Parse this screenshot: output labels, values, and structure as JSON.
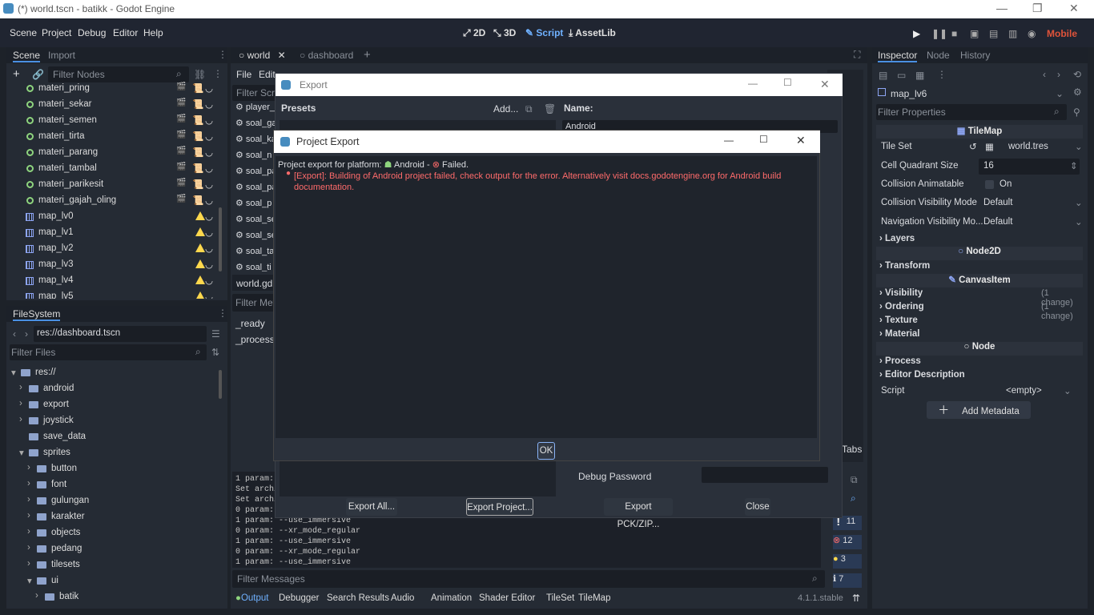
{
  "window": {
    "title": "(*) world.tscn - batikk - Godot Engine",
    "min": "—",
    "restore": "❐",
    "close": "✕"
  },
  "menu": [
    "Scene",
    "Project",
    "Debug",
    "Editor",
    "Help"
  ],
  "workspace": {
    "w2d": "2D",
    "w3d": "3D",
    "script": "Script",
    "assetlib": "AssetLib",
    "renderer": "Mobile"
  },
  "scene_dock": {
    "tabs": [
      "Scene",
      "Import"
    ],
    "filter_placeholder": "Filter Nodes",
    "nodes": [
      "materi_pring",
      "materi_sekar",
      "materi_semen",
      "materi_tirta",
      "materi_parang",
      "materi_tambal",
      "materi_parikesit",
      "materi_gajah_oling"
    ],
    "maps": [
      "map_lv0",
      "map_lv1",
      "map_lv2",
      "map_lv3",
      "map_lv4",
      "map_lv5"
    ]
  },
  "filesystem": {
    "tab": "FileSystem",
    "path": "res://dashboard.tscn",
    "filter_placeholder": "Filter Files",
    "items": [
      {
        "name": "res://",
        "indent": 0,
        "arrow": "▾"
      },
      {
        "name": "android",
        "indent": 1,
        "arrow": "›"
      },
      {
        "name": "export",
        "indent": 1,
        "arrow": "›"
      },
      {
        "name": "joystick",
        "indent": 1,
        "arrow": "›"
      },
      {
        "name": "save_data",
        "indent": 1,
        "arrow": ""
      },
      {
        "name": "sprites",
        "indent": 1,
        "arrow": "▾"
      },
      {
        "name": "button",
        "indent": 2,
        "arrow": "›"
      },
      {
        "name": "font",
        "indent": 2,
        "arrow": "›"
      },
      {
        "name": "gulungan",
        "indent": 2,
        "arrow": "›"
      },
      {
        "name": "karakter",
        "indent": 2,
        "arrow": "›"
      },
      {
        "name": "objects",
        "indent": 2,
        "arrow": "›"
      },
      {
        "name": "pedang",
        "indent": 2,
        "arrow": "›"
      },
      {
        "name": "tilesets",
        "indent": 2,
        "arrow": "›"
      },
      {
        "name": "ui",
        "indent": 2,
        "arrow": "▾"
      },
      {
        "name": "batik",
        "indent": 3,
        "arrow": "›"
      }
    ]
  },
  "editor_tabs": [
    "world",
    "dashboard"
  ],
  "script_menu": [
    "File",
    "Edit"
  ],
  "script_list": {
    "filter": "Filter Scripts",
    "items": [
      "player_",
      "soal_ga",
      "soal_ka",
      "soal_n",
      "soal_pa",
      "soal_pa",
      "soal_p",
      "soal_se",
      "soal_se",
      "soal_ta",
      "soal_ti"
    ],
    "current": "world.gd",
    "methods_filter": "Filter Met",
    "methods": [
      "_ready",
      "_process"
    ]
  },
  "output": {
    "lines": [
      "1 param: --",
      "Set archi",
      "Set archi",
      "0 param: -",
      "1 param: --use_immersive",
      "0 param: --xr_mode_regular",
      "1 param: --use_immersive",
      "0 param: --xr_mode_regular",
      "1 param: --use_immersive"
    ],
    "filter_placeholder": "Filter Messages",
    "counts": [
      "11",
      "12",
      "3",
      "7"
    ]
  },
  "bottom_tabs": [
    "Output",
    "Debugger",
    "Search Results",
    "Audio",
    "Animation",
    "Shader Editor",
    "TileSet",
    "TileMap"
  ],
  "version": "4.1.1.stable",
  "tabs_label": "Tabs",
  "export_dialog": {
    "title": "Export",
    "presets": "Presets",
    "add": "Add...",
    "name_label": "Name:",
    "name_value": "Android",
    "debug_password": "Debug Password",
    "buttons": {
      "export_all": "Export All...",
      "export_project": "Export Project...",
      "export_pck": "Export PCK/ZIP...",
      "close": "Close"
    }
  },
  "project_export": {
    "title": "Project Export",
    "line1_prefix": "Project export for platform:",
    "platform": "Android",
    "sep": "-",
    "status": "Failed.",
    "error": "[Export]: Building of Android project failed, check output for the error. Alternatively visit docs.godotengine.org for Android build documentation.",
    "ok": "OK"
  },
  "inspector": {
    "tabs": [
      "Inspector",
      "Node",
      "History"
    ],
    "node_name": "map_lv6",
    "filter_placeholder": "Filter Properties",
    "class": "TileMap",
    "props": [
      {
        "label": "Tile Set",
        "value": "world.tres"
      },
      {
        "label": "Cell Quadrant Size",
        "value": "16"
      },
      {
        "label": "Collision Animatable",
        "value": "On"
      },
      {
        "label": "Collision Visibility Mode",
        "value": "Default"
      },
      {
        "label": "Navigation Visibility Mo...",
        "value": "Default"
      }
    ],
    "groups": {
      "layers": "Layers",
      "node2d": "Node2D",
      "transform": "Transform",
      "canvasitem": "CanvasItem",
      "visibility": "Visibility",
      "ordering": "Ordering",
      "texture": "Texture",
      "material": "Material",
      "node": "Node",
      "process": "Process",
      "editor_desc": "Editor Description"
    },
    "change": "(1 change)",
    "script_label": "Script",
    "script_value": "<empty>",
    "add_metadata": "Add Metadata"
  },
  "colors": {
    "accent": "#4a90e2",
    "error": "#ff6b6b",
    "node_green": "#8ed47e",
    "warn": "#ffd84d"
  }
}
